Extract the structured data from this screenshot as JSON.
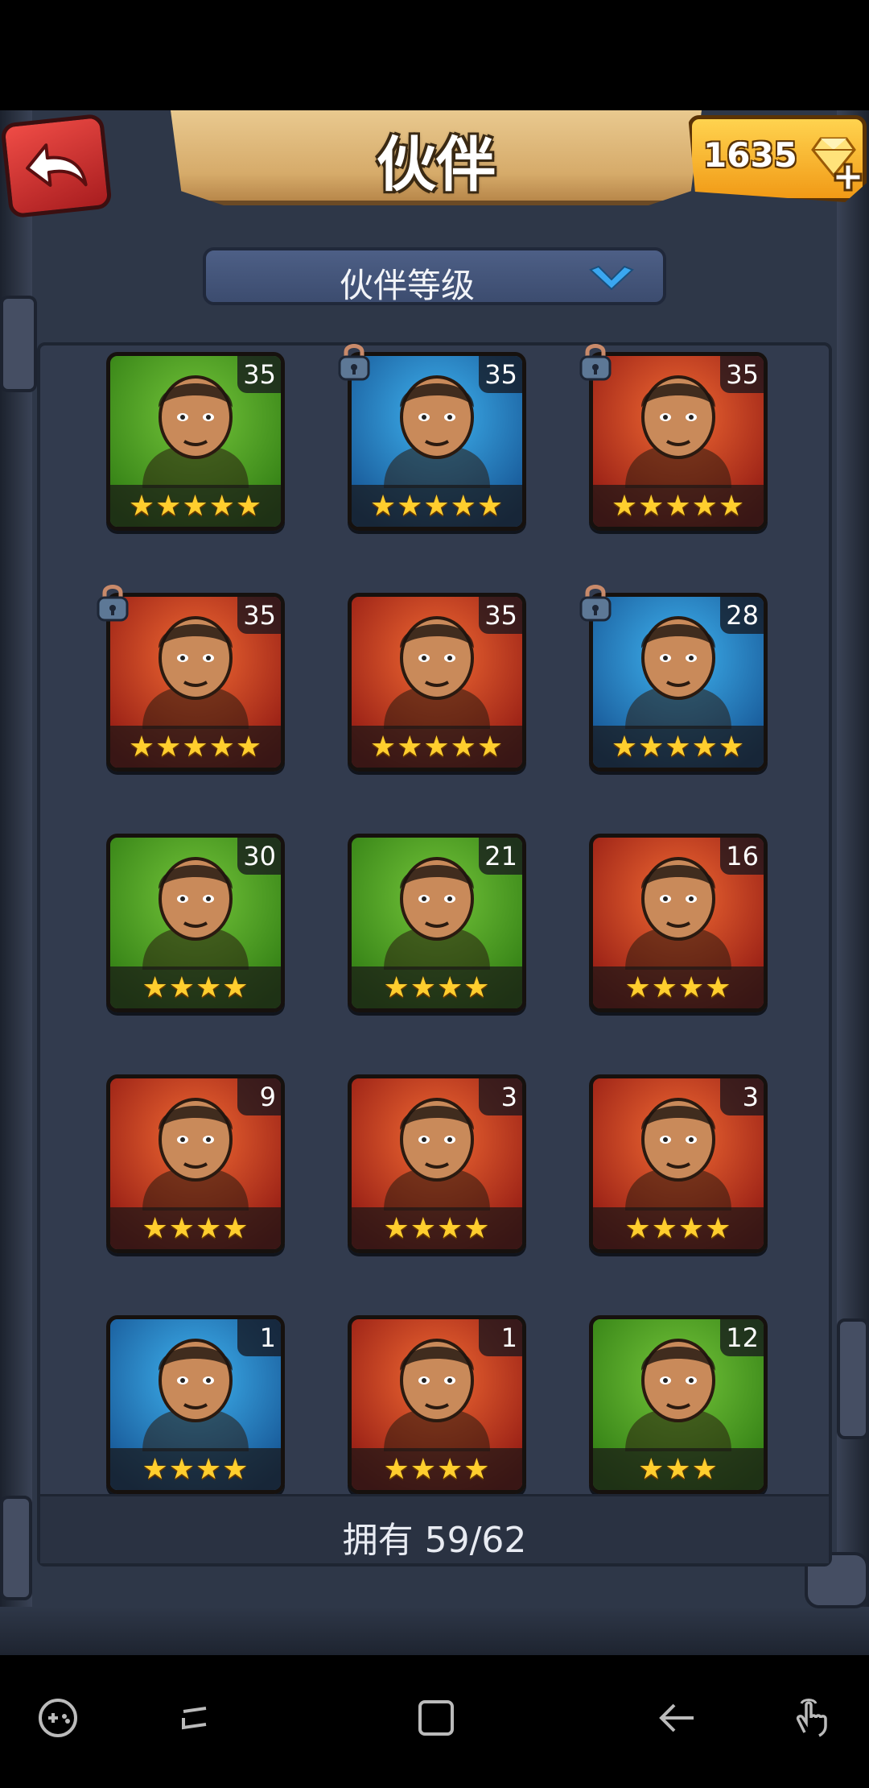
{
  "header": {
    "title": "伙伴",
    "gems": "1635"
  },
  "sort": {
    "label": "伙伴等级"
  },
  "roster": {
    "owned_text": "拥有 59/62",
    "cards": [
      {
        "level": "35",
        "stars": "★★★★★",
        "stars_count": 5,
        "theme": "green",
        "locked": false
      },
      {
        "level": "35",
        "stars": "★★★★★",
        "stars_count": 5,
        "theme": "blue",
        "locked": true
      },
      {
        "level": "35",
        "stars": "★★★★★",
        "stars_count": 5,
        "theme": "red",
        "locked": true
      },
      {
        "level": "35",
        "stars": "★★★★★",
        "stars_count": 5,
        "theme": "red",
        "locked": true
      },
      {
        "level": "35",
        "stars": "★★★★★",
        "stars_count": 5,
        "theme": "red",
        "locked": false
      },
      {
        "level": "28",
        "stars": "★★★★★",
        "stars_count": 5,
        "theme": "blue",
        "locked": true
      },
      {
        "level": "30",
        "stars": "★★★★",
        "stars_count": 4,
        "theme": "green",
        "locked": false
      },
      {
        "level": "21",
        "stars": "★★★★",
        "stars_count": 4,
        "theme": "green",
        "locked": false
      },
      {
        "level": "16",
        "stars": "★★★★",
        "stars_count": 4,
        "theme": "red",
        "locked": false
      },
      {
        "level": "9",
        "stars": "★★★★",
        "stars_count": 4,
        "theme": "red",
        "locked": false
      },
      {
        "level": "3",
        "stars": "★★★★",
        "stars_count": 4,
        "theme": "red",
        "locked": false
      },
      {
        "level": "3",
        "stars": "★★★★",
        "stars_count": 4,
        "theme": "red",
        "locked": false
      },
      {
        "level": "1",
        "stars": "★★★★",
        "stars_count": 4,
        "theme": "blue",
        "locked": false
      },
      {
        "level": "1",
        "stars": "★★★★",
        "stars_count": 4,
        "theme": "red",
        "locked": false
      },
      {
        "level": "12",
        "stars": "★★★",
        "stars_count": 3,
        "theme": "green",
        "locked": false
      }
    ]
  },
  "colors": {
    "green": "#3f9a1c",
    "blue": "#1f7fc9",
    "red": "#c8321c",
    "gold_star": "#ffce2e"
  },
  "icons": [
    "back-arrow-icon",
    "gem-icon",
    "add-gems-icon",
    "chevron-down-icon",
    "lock-icon",
    "game-tools-icon",
    "recent-apps-icon",
    "home-icon",
    "back-icon",
    "gesture-icon"
  ]
}
